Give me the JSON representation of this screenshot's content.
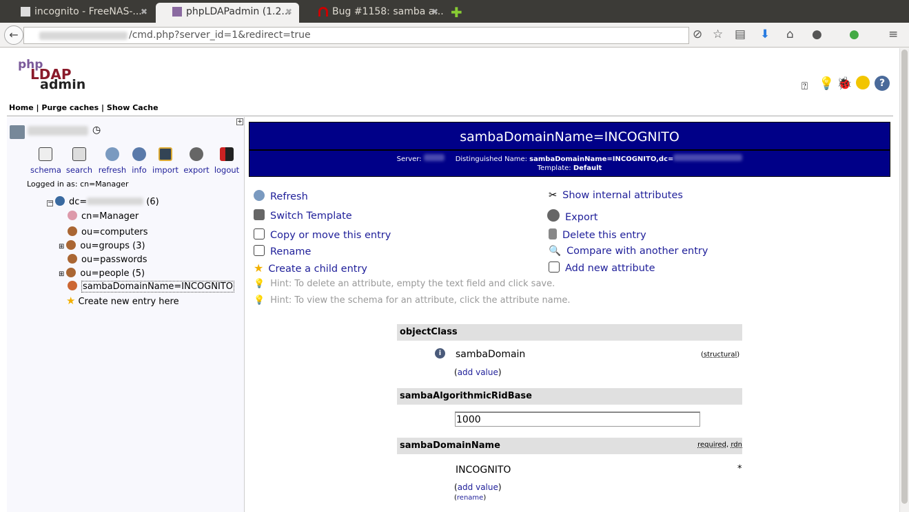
{
  "browser": {
    "tabs": [
      {
        "title": "incognito - FreeNAS-...",
        "active": false
      },
      {
        "title": "phpLDAPadmin (1.2...",
        "active": true
      },
      {
        "title": "Bug #1158: samba a...",
        "active": false
      }
    ],
    "url": "/cmd.php?server_id=1&redirect=true"
  },
  "logo": {
    "text": "phpLDAPadmin"
  },
  "topmenu": {
    "home": "Home",
    "purge": "Purge caches",
    "show_cache": "Show Cache",
    "sep": "|"
  },
  "left": {
    "tools": [
      {
        "label": "schema",
        "icon": "schema-icon"
      },
      {
        "label": "search",
        "icon": "search-icon"
      },
      {
        "label": "refresh",
        "icon": "refresh-icon"
      },
      {
        "label": "info",
        "icon": "info-icon"
      },
      {
        "label": "import",
        "icon": "import-icon"
      },
      {
        "label": "export",
        "icon": "export-icon"
      },
      {
        "label": "logout",
        "icon": "logout-icon"
      }
    ],
    "logged_in": "Logged in as: cn=Manager",
    "tree": {
      "root_prefix": "dc=",
      "root_count": "(6)",
      "items": [
        {
          "label": "cn=Manager"
        },
        {
          "label": "ou=computers"
        },
        {
          "label": "ou=groups (3)"
        },
        {
          "label": "ou=passwords"
        },
        {
          "label": "ou=people (5)"
        },
        {
          "label": "sambaDomainName=INCOGNITO"
        },
        {
          "label": "Create new entry here"
        }
      ]
    }
  },
  "header": {
    "title": "sambaDomainName=INCOGNITO",
    "server_label": "Server:",
    "dn_label": "Distinguished Name:",
    "dn_value": "sambaDomainName=INCOGNITO,dc=",
    "template_label": "Template:",
    "template_value": "Default",
    "bg_color": "#000088"
  },
  "actions": {
    "left": [
      "Refresh",
      "Switch Template",
      "Copy or move this entry",
      "Rename",
      "Create a child entry"
    ],
    "right": [
      "Show internal attributes",
      "Export",
      "Delete this entry",
      "Compare with another entry",
      "Add new attribute"
    ]
  },
  "hints": [
    "Hint: To delete an attribute, empty the text field and click save.",
    "Hint: To view the schema for an attribute, click the attribute name."
  ],
  "attributes": {
    "objectClass": {
      "name": "objectClass",
      "value": "sambaDomain",
      "note": "structural",
      "add": "add value"
    },
    "rid": {
      "name": "sambaAlgorithmicRidBase",
      "value": "1000"
    },
    "domain": {
      "name": "sambaDomainName",
      "value": "INCOGNITO",
      "flags_required": "required",
      "flags_rdn": "rdn",
      "star": "*",
      "add": "add value",
      "rename": "rename"
    }
  }
}
